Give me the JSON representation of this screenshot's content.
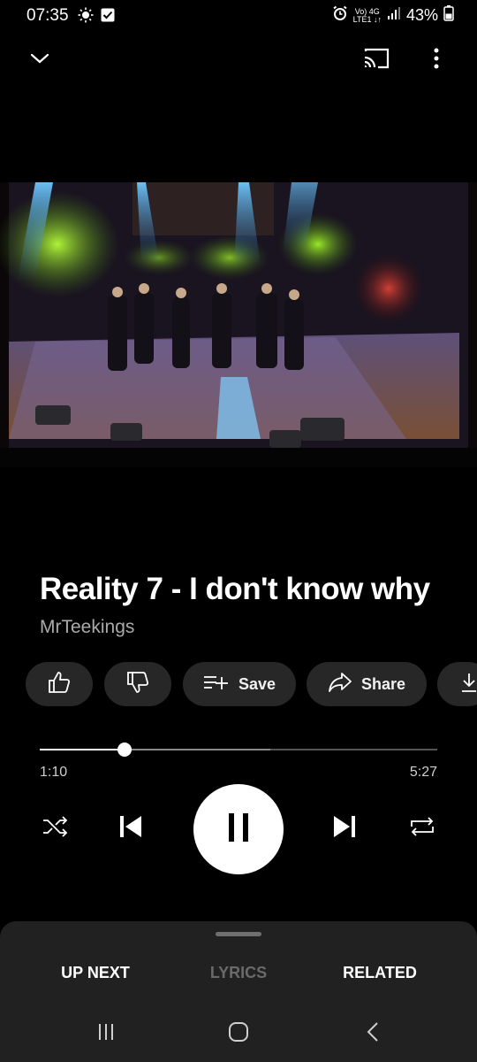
{
  "status_bar": {
    "time": "07:35",
    "network_top": "Vo) 4G",
    "network_bottom": "LTE1 ↓↑",
    "battery": "43%"
  },
  "top_bar": {
    "collapse_icon": "chevron-down-icon",
    "cast_icon": "cast-icon",
    "more_icon": "more-vertical-icon"
  },
  "player": {
    "title": "Reality 7 - I don't know why",
    "channel": "MrTeekings",
    "elapsed": "1:10",
    "duration": "5:27",
    "progress_fraction": 0.214,
    "buffered_fraction": 0.58
  },
  "actions": {
    "like_icon": "thumbs-up-icon",
    "dislike_icon": "thumbs-down-icon",
    "save_label": "Save",
    "share_label": "Share",
    "download_icon": "download-icon"
  },
  "controls": {
    "shuffle_icon": "shuffle-icon",
    "previous_icon": "skip-previous-icon",
    "pause_icon": "pause-icon",
    "next_icon": "skip-next-icon",
    "repeat_icon": "repeat-icon"
  },
  "sheet": {
    "tabs": [
      {
        "label": "UP NEXT",
        "enabled": true
      },
      {
        "label": "LYRICS",
        "enabled": false
      },
      {
        "label": "RELATED",
        "enabled": true
      }
    ]
  },
  "nav_bar": {
    "recents_icon": "recents-icon",
    "home_icon": "home-icon",
    "back_icon": "back-icon"
  },
  "colors": {
    "background": "#000000",
    "pill": "#272727",
    "sheet": "#212121",
    "secondary_text": "#aaaaaa",
    "disabled_tab": "#6a6a6a"
  }
}
